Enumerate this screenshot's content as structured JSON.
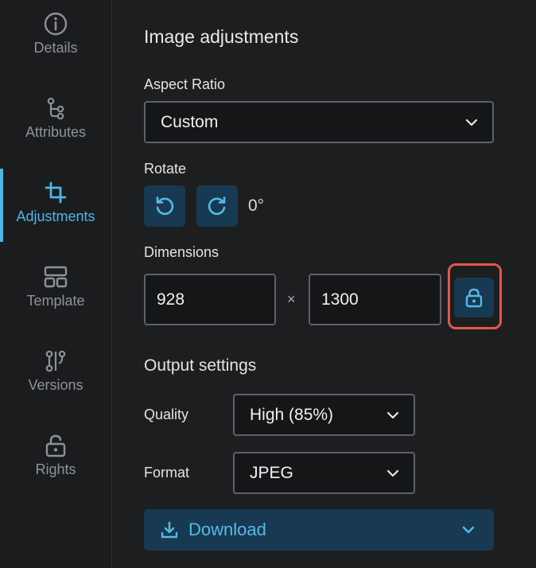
{
  "sidebar": {
    "items": [
      {
        "label": "Details",
        "icon": "info-icon"
      },
      {
        "label": "Attributes",
        "icon": "branch-icon"
      },
      {
        "label": "Adjustments",
        "icon": "crop-icon",
        "active": true
      },
      {
        "label": "Template",
        "icon": "template-icon"
      },
      {
        "label": "Versions",
        "icon": "versions-icon"
      },
      {
        "label": "Rights",
        "icon": "unlock-icon"
      }
    ]
  },
  "panel": {
    "title": "Image adjustments",
    "aspect_ratio": {
      "label": "Aspect Ratio",
      "value": "Custom"
    },
    "rotate": {
      "label": "Rotate",
      "value": "0°"
    },
    "dimensions": {
      "label": "Dimensions",
      "width": "928",
      "height": "1300",
      "separator": "×"
    },
    "output": {
      "title": "Output settings",
      "quality": {
        "label": "Quality",
        "value": "High (85%)"
      },
      "format": {
        "label": "Format",
        "value": "JPEG"
      }
    },
    "download": {
      "label": "Download"
    }
  },
  "colors": {
    "accent": "#4fb6e6",
    "button_bg": "#173a52",
    "highlight": "#e2584a",
    "background": "#1d1e20"
  }
}
